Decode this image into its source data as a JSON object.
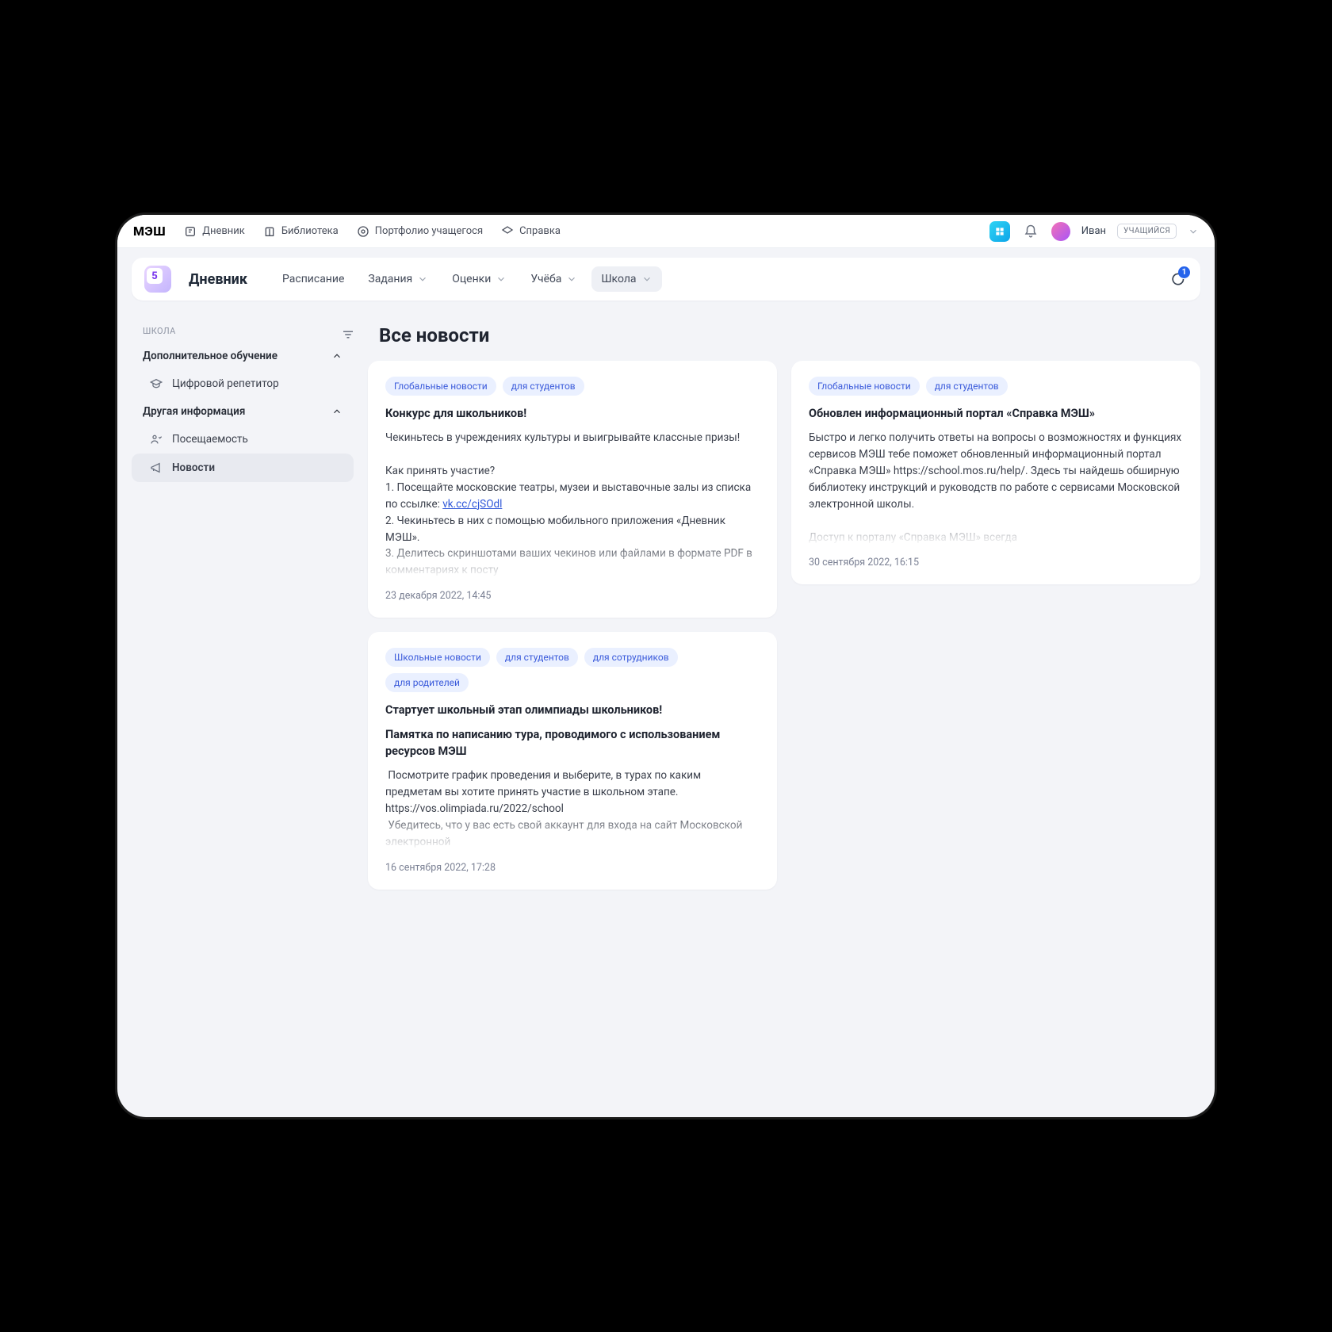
{
  "topbar": {
    "logo": "МЭШ",
    "items": [
      {
        "label": "Дневник"
      },
      {
        "label": "Библиотека"
      },
      {
        "label": "Портфолио учащегося"
      },
      {
        "label": "Справка"
      }
    ],
    "user_name": "Иван",
    "role_badge": "УЧАЩИЙСЯ"
  },
  "subbar": {
    "title": "Дневник",
    "tabs": [
      {
        "label": "Расписание",
        "has_chevron": false
      },
      {
        "label": "Задания",
        "has_chevron": true
      },
      {
        "label": "Оценки",
        "has_chevron": true
      },
      {
        "label": "Учёба",
        "has_chevron": true
      },
      {
        "label": "Школа",
        "has_chevron": true,
        "active": true
      }
    ],
    "chat_badge": "1"
  },
  "sidebar": {
    "section_label": "ШКОЛА",
    "groups": [
      {
        "title": "Дополнительное обучение",
        "items": [
          {
            "label": "Цифровой репетитор",
            "icon": "graduation"
          }
        ]
      },
      {
        "title": "Другая информация",
        "items": [
          {
            "label": "Посещаемость",
            "icon": "attendance"
          },
          {
            "label": "Новости",
            "icon": "megaphone",
            "active": true
          }
        ]
      }
    ]
  },
  "page": {
    "title": "Все новости"
  },
  "news": [
    {
      "chips": [
        "Глобальные новости",
        "для студентов"
      ],
      "title": "Конкурс для школьников!",
      "body_html": "Чекиньтесь в учреждениях культуры и выигрывайте классные призы!<br><br>Как принять участие?<br>1. Посещайте московские театры, музеи и выставочные залы из списка по ссылке: <a href='#'>vk.cc/cjSOdl</a><br>2. Чекиньтесь в них с помощью мобильного приложения «Дневник МЭШ».<br>3. Делитесь скриншотами ваших чекинов или файлами в формате PDF в комментариях к посту",
      "date": "23 декабря 2022, 14:45"
    },
    {
      "chips": [
        "Глобальные новости",
        "для студентов"
      ],
      "title": "Обновлен информационный портал «Справка МЭШ»",
      "body_html": "Быстро и легко получить ответы на вопросы о возможностях и функциях сервисов МЭШ тебе поможет обновленный информационный портал «Справка МЭШ» https://school.mos.ru/help/. Здесь ты найдешь обширную библиотеку инструкций и руководств по работе с сервисами Московской электронной школы.<br><br>Доступ к порталу «Справка МЭШ» всегда",
      "date": "30 сентября 2022, 16:15"
    },
    {
      "chips": [
        "Школьные новости",
        "для студентов",
        "для сотрудников",
        "для родителей"
      ],
      "title": "Стартует школьный этап олимпиады школьников!",
      "subtitle": "Памятка по написанию тура, проводимого с использованием ресурсов МЭШ",
      "body_html": "&nbsp;Посмотрите график проведения и выберите, в турах по каким предметам вы хотите принять участие в школьном этапе. https://vos.olimpiada.ru/2022/school<br>&nbsp;Убедитесь, что у вас есть свой аккаунт для входа на сайт Московской электронной",
      "date": "16 сентября 2022, 17:28"
    }
  ]
}
